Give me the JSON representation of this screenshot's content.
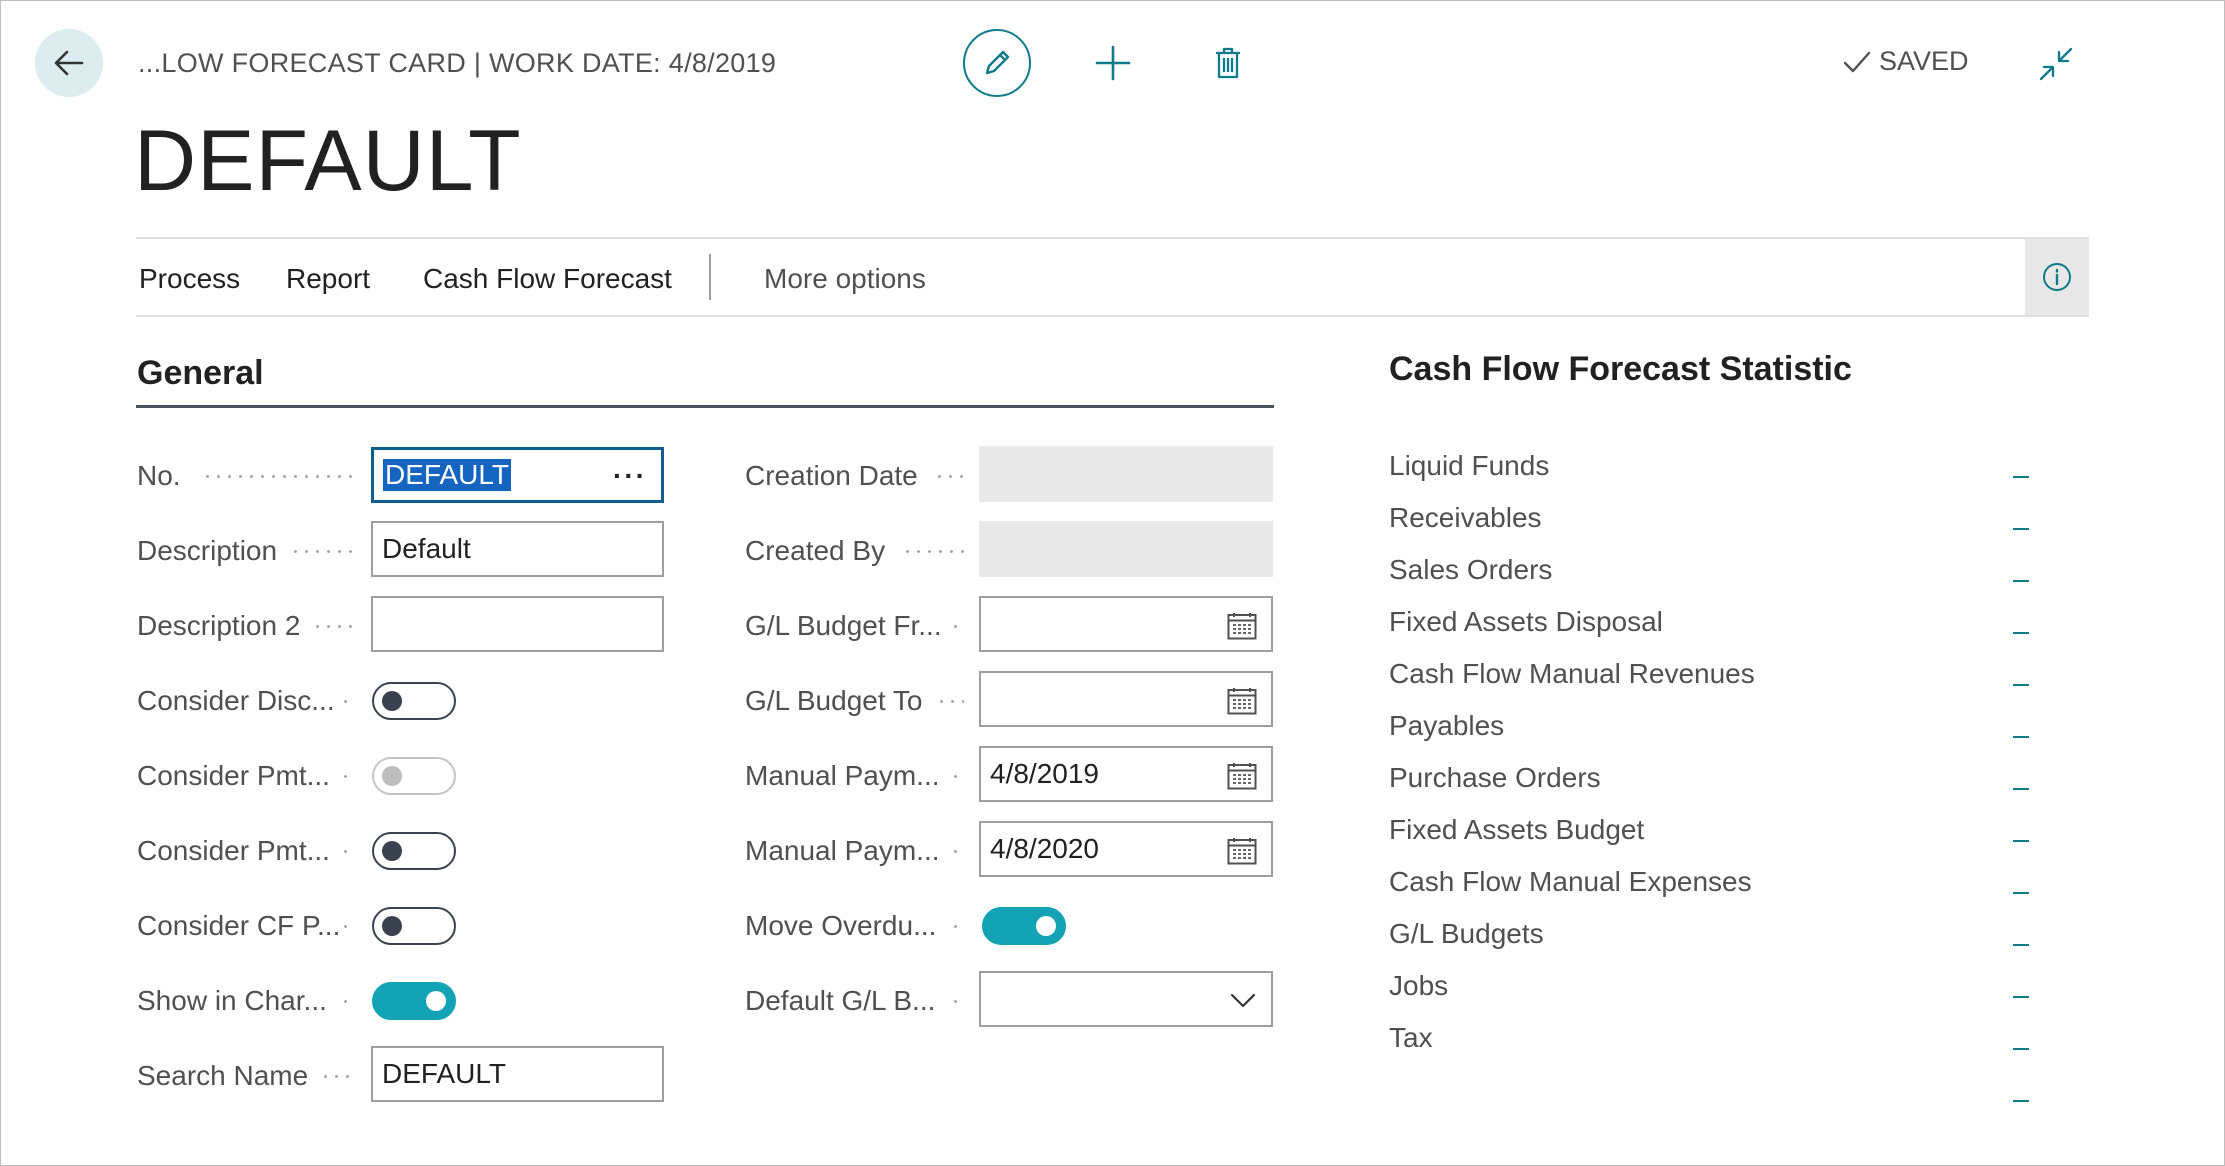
{
  "header": {
    "breadcrumb": "...LOW FORECAST CARD | WORK DATE: 4/8/2019",
    "title": "DEFAULT",
    "status": "SAVED"
  },
  "actions": {
    "process": "Process",
    "report": "Report",
    "cash_flow_forecast": "Cash Flow Forecast",
    "more_options": "More options"
  },
  "general": {
    "title": "General",
    "no_label": "No.",
    "no_value": "DEFAULT",
    "description_label": "Description",
    "description_value": "Default",
    "description2_label": "Description 2",
    "description2_value": "",
    "consider_disc_label": "Consider Disc...",
    "consider_pmt1_label": "Consider Pmt...",
    "consider_pmt2_label": "Consider Pmt...",
    "consider_cf_label": "Consider CF P...",
    "show_in_chart_label": "Show in Char...",
    "search_name_label": "Search Name",
    "search_name_value": "DEFAULT",
    "creation_date_label": "Creation Date",
    "creation_date_value": "",
    "created_by_label": "Created By",
    "created_by_value": "",
    "gl_budget_from_label": "G/L Budget Fr...",
    "gl_budget_from_value": "",
    "gl_budget_to_label": "G/L Budget To",
    "gl_budget_to_value": "",
    "manual_pay_from_label": "Manual Paym...",
    "manual_pay_from_value": "4/8/2019",
    "manual_pay_to_label": "Manual Paym...",
    "manual_pay_to_value": "4/8/2020",
    "move_overdue_label": "Move Overdu...",
    "default_gl_label": "Default G/L B...",
    "default_gl_value": "",
    "toggles": {
      "consider_disc": false,
      "consider_pmt1": false,
      "consider_pmt2": false,
      "consider_cf": false,
      "show_in_chart": true,
      "move_overdue": true
    }
  },
  "statistics": {
    "title": "Cash Flow Forecast Statistic",
    "items": [
      "Liquid Funds",
      "Receivables",
      "Sales Orders",
      "Fixed Assets Disposal",
      "Cash Flow Manual Revenues",
      "Payables",
      "Purchase Orders",
      "Fixed Assets Budget",
      "Cash Flow Manual Expenses",
      "G/L Budgets",
      "Jobs",
      "Tax"
    ]
  },
  "colors": {
    "accent": "#0e7a8a",
    "toggle_on": "#13a3b5",
    "selection": "#1565c0"
  },
  "icons": [
    "back-arrow-icon",
    "pencil-icon",
    "plus-icon",
    "trash-icon",
    "checkmark-icon",
    "collapse-icon",
    "info-icon",
    "calendar-icon",
    "chevron-down-icon"
  ]
}
